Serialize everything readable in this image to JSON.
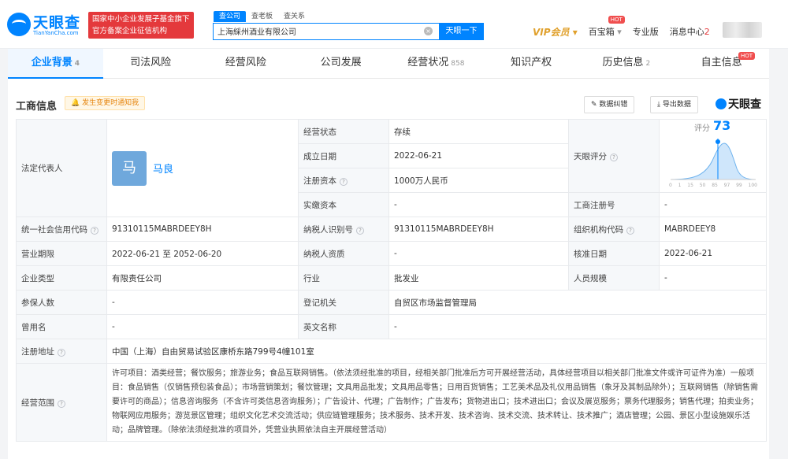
{
  "header": {
    "logo_cn": "天眼查",
    "logo_en": "TianYanCha.com",
    "badge_line1": "国家中小企业发展子基金旗下",
    "badge_line2": "官方备案企业征信机构",
    "search_tabs": [
      "查公司",
      "查老板",
      "查关系"
    ],
    "search_value": "上海綵州酒业有限公司",
    "search_button": "天眼一下",
    "nav": {
      "vip": "VIP会员",
      "baibaoxiang": "百宝箱",
      "hot": "HOT",
      "pro": "专业版",
      "messages": "消息中心",
      "message_count": "2"
    }
  },
  "tabs": [
    {
      "label": "企业背景",
      "count": "4"
    },
    {
      "label": "司法风险",
      "count": ""
    },
    {
      "label": "经营风险",
      "count": ""
    },
    {
      "label": "公司发展",
      "count": ""
    },
    {
      "label": "经营状况",
      "count": "858"
    },
    {
      "label": "知识产权",
      "count": ""
    },
    {
      "label": "历史信息",
      "count": "2"
    },
    {
      "label": "自主信息",
      "count": "",
      "hot": "HOT"
    }
  ],
  "section": {
    "title": "工商信息",
    "notify": "发生变更时通知我",
    "correct_button": "数据纠错",
    "export_button": "导出数据",
    "brand": "天眼查"
  },
  "info": {
    "legal_rep_label": "法定代表人",
    "legal_rep_avatar": "马",
    "legal_rep_name": "马良",
    "status_label": "经营状态",
    "status_value": "存续",
    "founded_label": "成立日期",
    "founded_value": "2022-06-21",
    "capital_label": "注册资本",
    "capital_value": "1000万人民币",
    "paid_label": "实缴资本",
    "paid_value": "-",
    "score_label": "天眼评分",
    "score_title": "评分",
    "score_value": "73",
    "score_ticks": [
      "0",
      "1",
      "15",
      "50",
      "85",
      "97",
      "99",
      "100"
    ],
    "reg_no_label": "工商注册号",
    "reg_no_value": "-",
    "credit_code_label": "统一社会信用代码",
    "credit_code_value": "91310115MABRDEEY8H",
    "taxpayer_id_label": "纳税人识别号",
    "taxpayer_id_value": "91310115MABRDEEY8H",
    "org_code_label": "组织机构代码",
    "org_code_value": "MABRDEEY8",
    "term_label": "营业期限",
    "term_value": "2022-06-21 至 2052-06-20",
    "taxpayer_qual_label": "纳税人资质",
    "taxpayer_qual_value": "-",
    "approve_label": "核准日期",
    "approve_value": "2022-06-21",
    "type_label": "企业类型",
    "type_value": "有限责任公司",
    "industry_label": "行业",
    "industry_value": "批发业",
    "scale_label": "人员规模",
    "scale_value": "-",
    "insured_label": "参保人数",
    "insured_value": "-",
    "authority_label": "登记机关",
    "authority_value": "自贸区市场监督管理局",
    "former_label": "曾用名",
    "former_value": "-",
    "en_name_label": "英文名称",
    "en_name_value": "-",
    "address_label": "注册地址",
    "address_value": "中国（上海）自由贸易试验区康桥东路799号4幢101室",
    "scope_label": "经营范围",
    "scope_value": "许可项目：酒类经营；餐饮服务；旅游业务；食品互联网销售。（依法须经批准的项目，经相关部门批准后方可开展经营活动，具体经营项目以相关部门批准文件或许可证件为准）一般项目：食品销售（仅销售预包装食品）；市场营销策划；餐饮管理；文具用品批发；文具用品零售；日用百货销售；工艺美术品及礼仪用品销售（象牙及其制品除外）；互联网销售（除销售需要许可的商品）；信息咨询服务（不含许可类信息咨询服务）；广告设计、代理；广告制作；广告发布；货物进出口；技术进出口；会议及展览服务；票务代理服务；销售代理；拍卖业务；物联网应用服务；游览景区管理；组织文化艺术交流活动；供应链管理服务；技术服务、技术开发、技术咨询、技术交流、技术转让、技术推广；酒店管理；公园、景区小型设施娱乐活动；品牌管理。（除依法须经批准的项目外，凭营业执照依法自主开展经营活动）"
  },
  "colors": {
    "brand": "#0084ff",
    "badge": "#e4393c",
    "vip": "#e0a02b"
  }
}
